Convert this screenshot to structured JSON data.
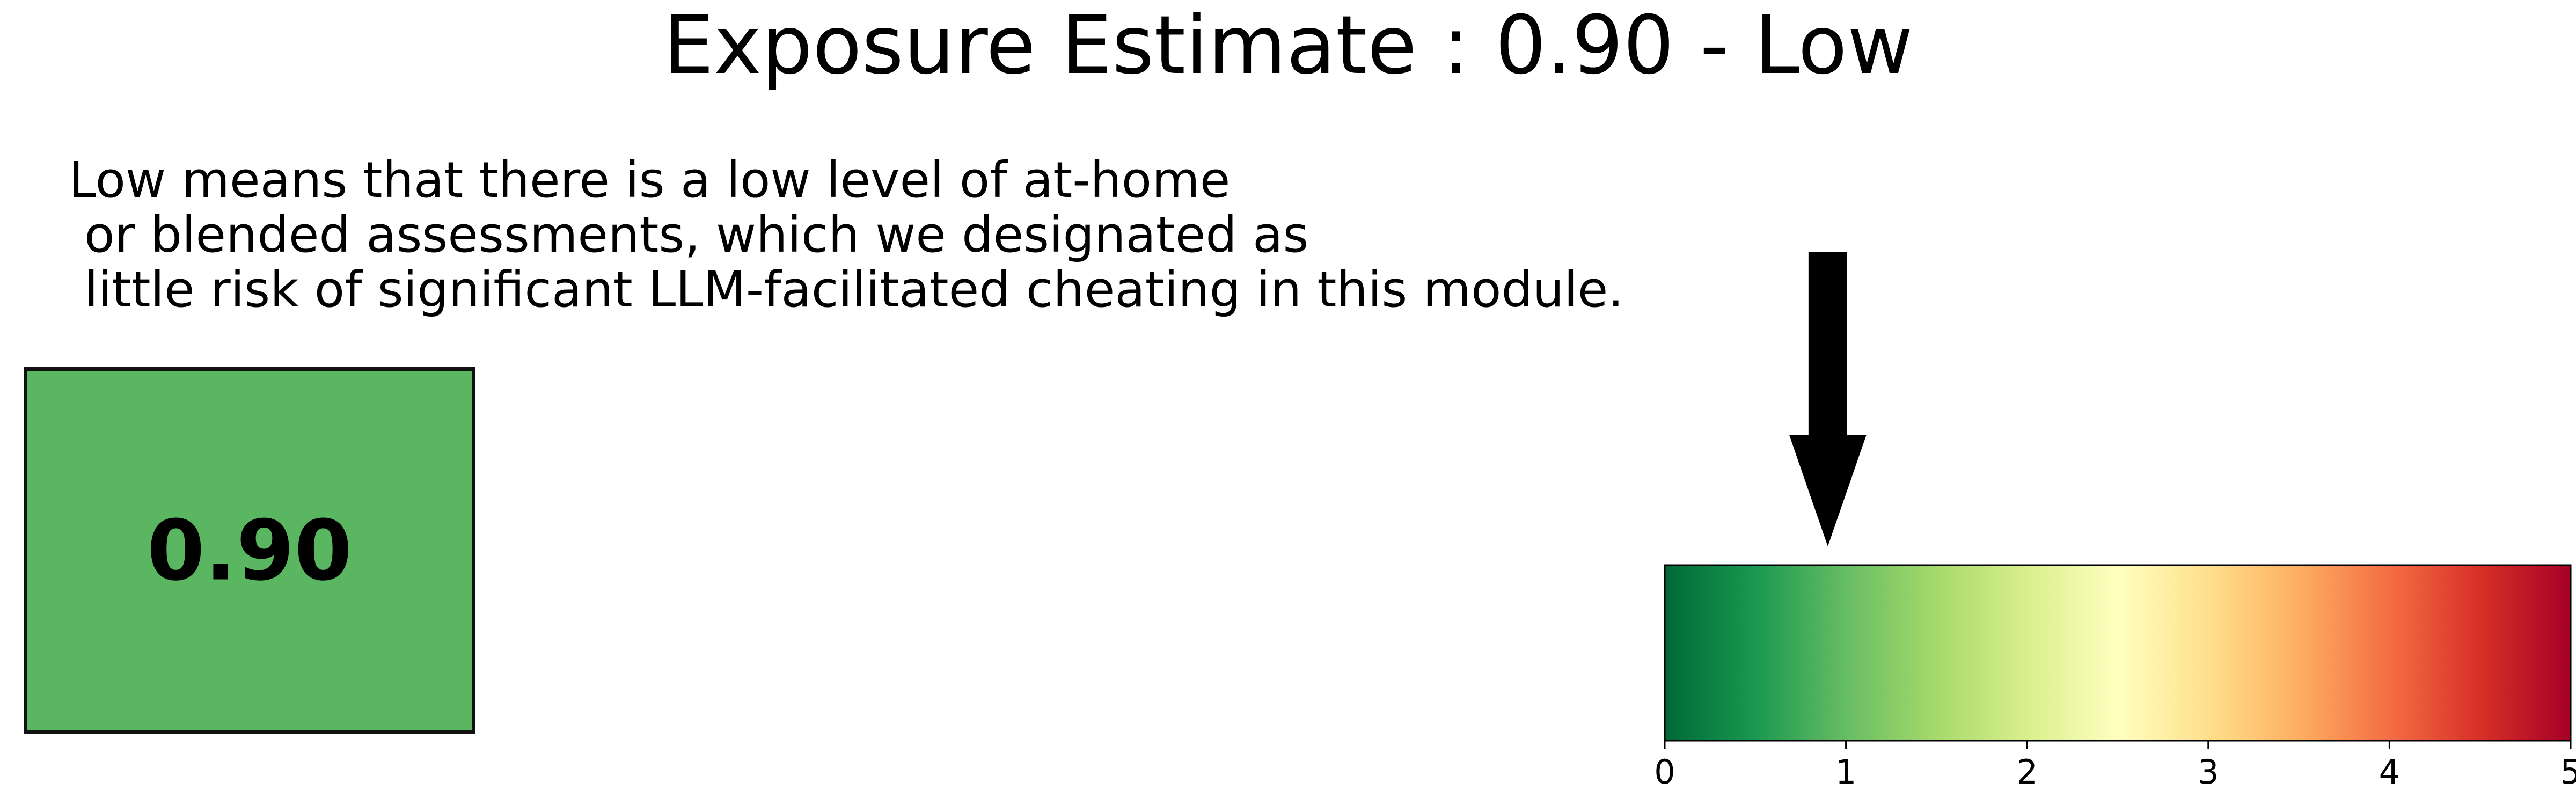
{
  "title": "Exposure Estimate : 0.90 - Low",
  "description": "Low means that there is a low level of at-home\n or blended assessments, which we designated as\n little risk of significant LLM-facilitated cheating in this module.",
  "score": {
    "label": "0.90",
    "color": "#5ab660"
  },
  "chart_data": {
    "type": "gauge",
    "value": 0.9,
    "xlim": [
      0,
      5
    ],
    "ticks": [
      0,
      1,
      2,
      3,
      4,
      5
    ],
    "tick_labels": [
      "0",
      "1",
      "2",
      "3",
      "4",
      "5"
    ],
    "colormap": "RdYlGn_r",
    "colormap_stops": [
      "#006837",
      "#1a9850",
      "#66bd63",
      "#a6d96a",
      "#d9ef8b",
      "#ffffbf",
      "#fee08b",
      "#fdae61",
      "#f46d43",
      "#d73027",
      "#a50026"
    ],
    "marker": "downward arrow",
    "grid": false
  }
}
